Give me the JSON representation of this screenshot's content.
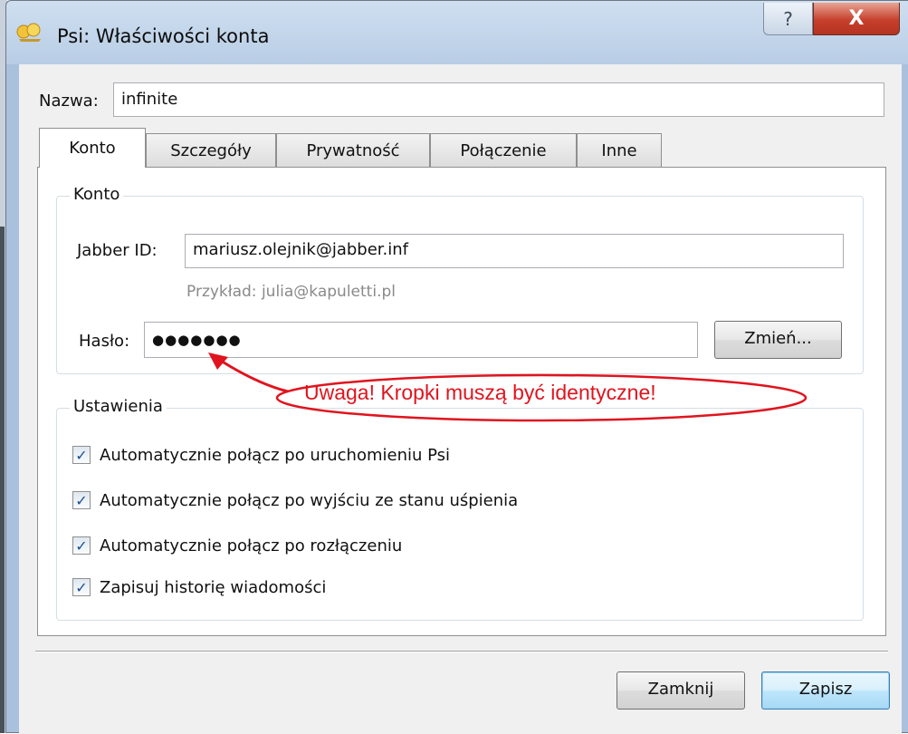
{
  "window": {
    "title": "Psi: Właściwości konta",
    "help_label": "?",
    "close_label": "X"
  },
  "name": {
    "label": "Nazwa:",
    "value": "infinite"
  },
  "tabs": [
    {
      "label": "Konto",
      "active": true
    },
    {
      "label": "Szczegóły",
      "active": false
    },
    {
      "label": "Prywatność",
      "active": false
    },
    {
      "label": "Połączenie",
      "active": false
    },
    {
      "label": "Inne",
      "active": false
    }
  ],
  "account_group": {
    "title": "Konto",
    "jid_label": "Jabber ID:",
    "jid_value": "mariusz.olejnik@jabber.inf",
    "example_hint": "Przykład: julia@kapuletti.pl",
    "password_label": "Hasło:",
    "password_value": "●●●●●●●",
    "change_button": "Zmień..."
  },
  "settings_group": {
    "title": "Ustawienia",
    "options": [
      {
        "label": "Automatycznie połącz po uruchomieniu Psi",
        "checked": true
      },
      {
        "label": "Automatycznie połącz po wyjściu ze stanu uśpienia",
        "checked": true
      },
      {
        "label": "Automatycznie połącz po rozłączeniu",
        "checked": true
      },
      {
        "label": "Zapisuj historię wiadomości",
        "checked": true
      }
    ]
  },
  "buttons": {
    "close": "Zamknij",
    "save": "Zapisz"
  },
  "annotation": {
    "text": "Uwaga! Kropki muszą być identyczne!",
    "color": "#e0141e"
  },
  "colors": {
    "titlebar": "#b8cde5",
    "close_button": "#c6402c",
    "dialog_bg": "#f0f0f0"
  }
}
